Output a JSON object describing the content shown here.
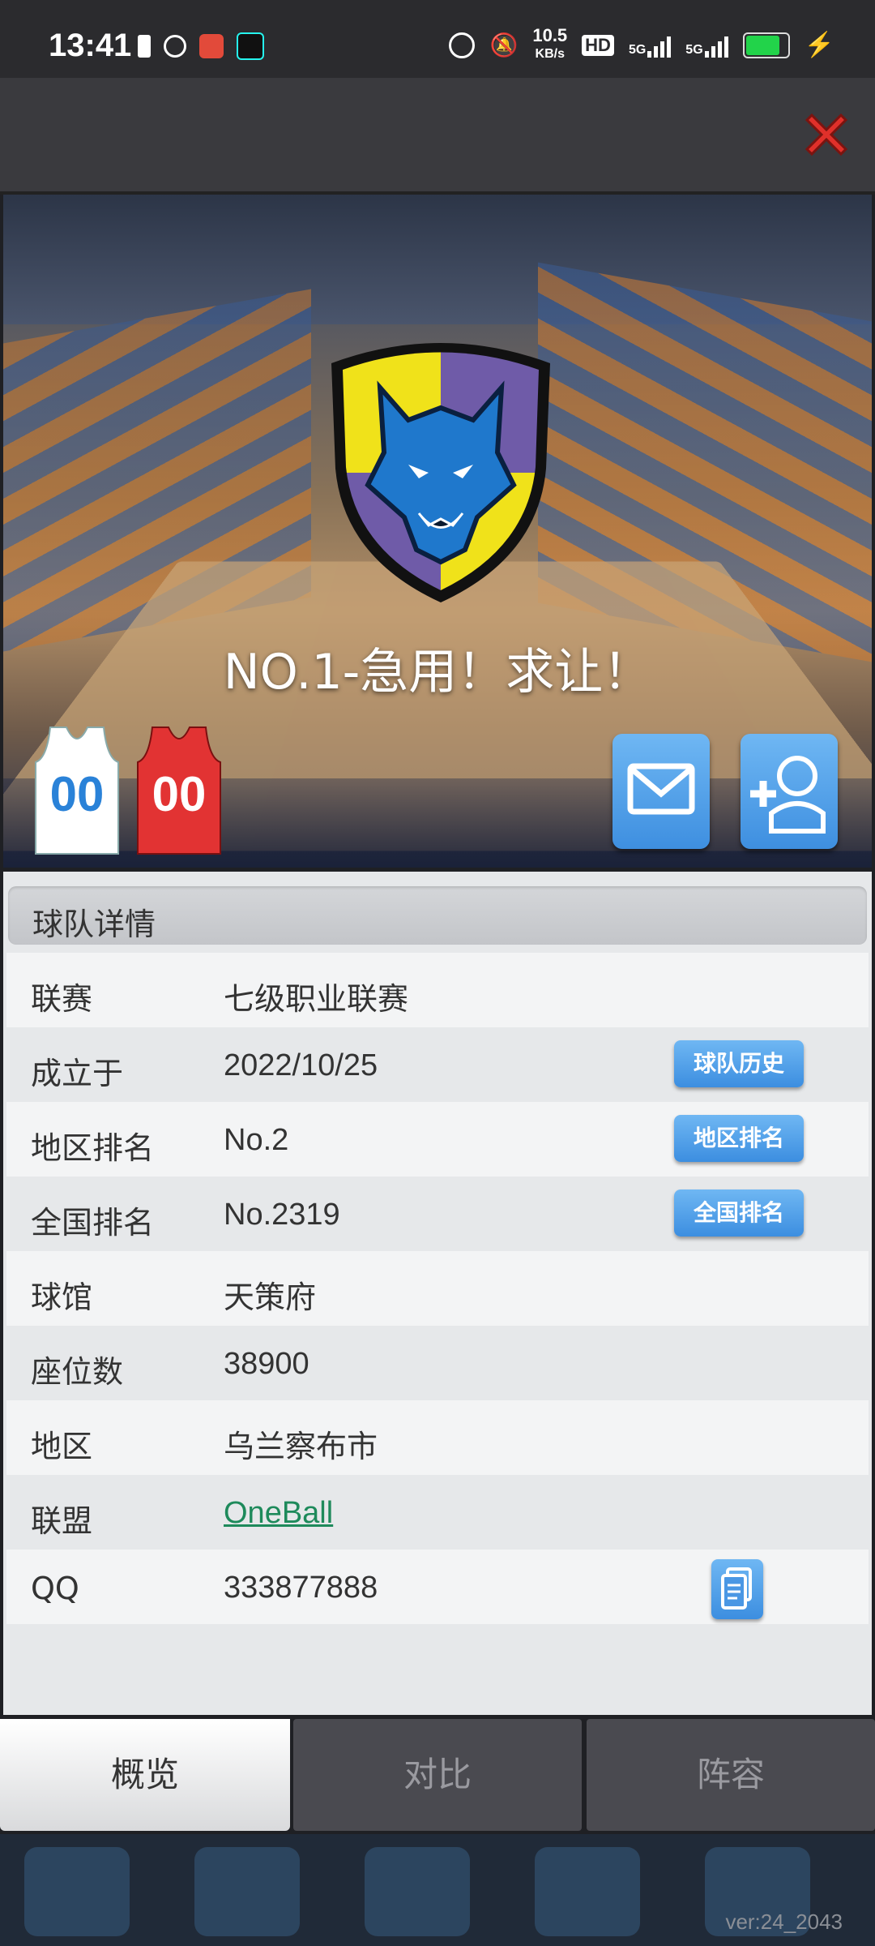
{
  "status_bar": {
    "time": "13:41",
    "net_speed_value": "10.5",
    "net_speed_unit": "KB/s",
    "hd_label": "HD",
    "signal_1": "5G",
    "signal_2": "5G",
    "battery_level": 0.85,
    "battery_color": "#22d34a"
  },
  "header": {
    "close_icon": "close-x-icon",
    "close_color": "#e0302a"
  },
  "banner": {
    "team_name": "NO.1-急用！求让！",
    "home_jersey_number": "00",
    "away_jersey_number": "00",
    "home_jersey_color": "#ffffff",
    "away_jersey_color": "#e23333",
    "mail_icon": "mail-icon",
    "add_friend_icon": "add-friend-icon"
  },
  "details": {
    "section_title": "球队详情",
    "rows": [
      {
        "label": "联赛",
        "value": "七级职业联赛"
      },
      {
        "label": "成立于",
        "value": "2022/10/25",
        "button": "球队历史"
      },
      {
        "label": "地区排名",
        "value": "No.2",
        "button": "地区排名"
      },
      {
        "label": "全国排名",
        "value": "No.2319",
        "button": "全国排名"
      },
      {
        "label": "球馆",
        "value": "天策府"
      },
      {
        "label": "座位数",
        "value": "38900"
      },
      {
        "label": "地区",
        "value": "乌兰察布市"
      },
      {
        "label": "联盟",
        "value": "OneBall"
      },
      {
        "label": "QQ",
        "value": "333877888",
        "copy_icon": "copy-document-icon"
      }
    ]
  },
  "tabs": [
    {
      "label": "概览",
      "active": true
    },
    {
      "label": "对比",
      "active": false
    },
    {
      "label": "阵容",
      "active": false
    }
  ],
  "footer": {
    "version": "ver:24_2043"
  },
  "accent_color": "#4a9be6"
}
